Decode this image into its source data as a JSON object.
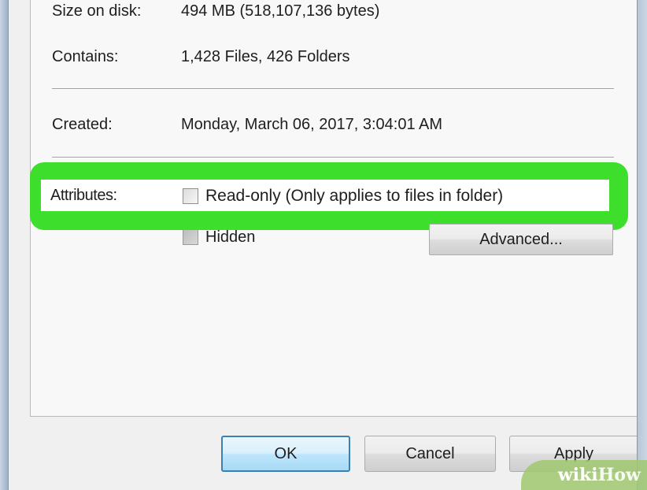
{
  "general": {
    "size_on_disk_label": "Size on disk:",
    "size_on_disk_value": "494 MB (518,107,136 bytes)",
    "contains_label": "Contains:",
    "contains_value": "1,428 Files, 426 Folders",
    "created_label": "Created:",
    "created_value": "Monday, March 06, 2017, 3:04:01 AM",
    "attributes_label": "Attributes:",
    "read_only_label": "Read-only (Only applies to files in folder)",
    "read_only_state": "indeterminate",
    "hidden_label": "Hidden",
    "hidden_checked": false,
    "advanced_button": "Advanced..."
  },
  "footer": {
    "ok_button": "OK",
    "cancel_button": "Cancel",
    "apply_button": "Apply"
  },
  "watermark": {
    "part1": "wiki",
    "part2": "How"
  },
  "colors": {
    "highlight": "#3ddf2c",
    "primary_button_border": "#3c7fb1",
    "dialog_background": "#f0f0f0"
  }
}
